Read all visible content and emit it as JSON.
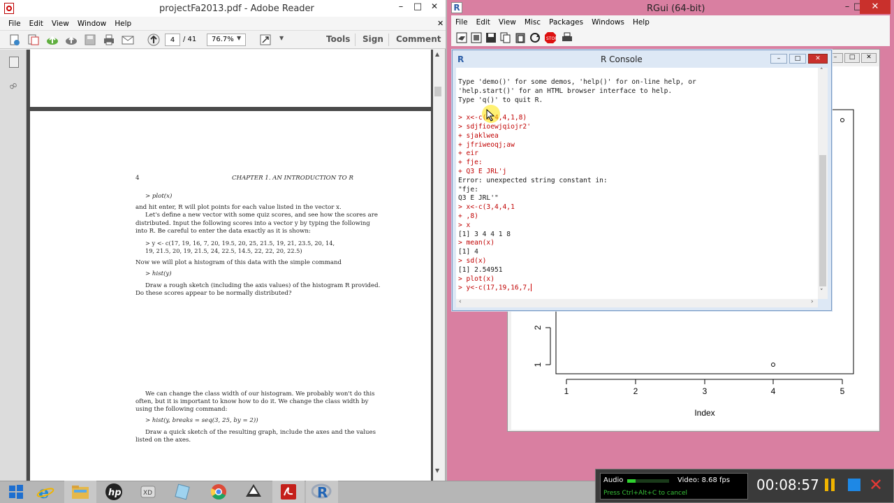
{
  "reader": {
    "title": "projectFa2013.pdf - Adobe Reader",
    "menu": [
      "File",
      "Edit",
      "View",
      "Window",
      "Help"
    ],
    "page_current": "4",
    "page_total": "/ 41",
    "zoom": "76.7%",
    "tools_label": "Tools",
    "sign_label": "Sign",
    "comment_label": "Comment",
    "page": {
      "page_number": "4",
      "chapter_header": "CHAPTER 1.   AN INTRODUCTION TO R",
      "lines": [
        "> plot(x)",
        "and hit enter, R will plot points for each value listed in the vector x.",
        "Let's define a new vector with some quiz scores, and see how the scores are",
        "distributed.  Input the following scores into a vector y by typing the following",
        "into R. Be careful to enter the data exactly as it is shown:",
        "> y <- c(17, 19, 16, 7, 20, 19.5, 20, 25, 21.5, 19, 21, 23.5, 20, 14,",
        "19, 21.5, 20, 19, 21.5, 24, 22.5, 14.5, 22, 22, 20, 22.5)",
        "Now we will plot a histogram of this data with the simple command",
        "> hist(y)",
        "Draw a rough sketch (including the axis values) of the histogram R provided.",
        "Do these scores appear to be normally distributed?",
        "We can change the class width of our histogram. We probably won't do this",
        "often, but it is important to know how to do it. We change the class width by",
        "using the following command:",
        "> hist(y, breaks = seq(3, 25, by = 2))",
        "Draw a quick sketch of the resulting graph, include the axes and the values",
        "listed on the axes."
      ]
    }
  },
  "rgui": {
    "title": "RGui (64-bit)",
    "menu": [
      "File",
      "Edit",
      "View",
      "Misc",
      "Packages",
      "Windows",
      "Help"
    ],
    "console_title": "R Console",
    "console_lines": [
      {
        "t": "Type 'demo()' for some demos, 'help()' for on-line help, or",
        "k": "out"
      },
      {
        "t": "'help.start()' for an HTML browser interface to help.",
        "k": "out"
      },
      {
        "t": "Type 'q()' to quit R.",
        "k": "out"
      },
      {
        "t": "",
        "k": "out"
      },
      {
        "t": "> x<-c(3,4,4,1,8)",
        "k": "in"
      },
      {
        "t": "> sdjfioewjqiojr2'",
        "k": "in"
      },
      {
        "t": "+ sjaklwea",
        "k": "in"
      },
      {
        "t": "+ jfriweoqj;aw",
        "k": "in"
      },
      {
        "t": "+ eir",
        "k": "in"
      },
      {
        "t": "+ fje:",
        "k": "in"
      },
      {
        "t": "+ Q3 E JRL'j",
        "k": "in"
      },
      {
        "t": "Error: unexpected string constant in:",
        "k": "out"
      },
      {
        "t": "\"fje:",
        "k": "out"
      },
      {
        "t": "Q3 E JRL'\"",
        "k": "out"
      },
      {
        "t": "> x<-c(3,4,4,1",
        "k": "in"
      },
      {
        "t": "+ ,8)",
        "k": "in"
      },
      {
        "t": "> x",
        "k": "in"
      },
      {
        "t": "[1] 3 4 4 1 8",
        "k": "out"
      },
      {
        "t": "> mean(x)",
        "k": "in"
      },
      {
        "t": "[1] 4",
        "k": "out"
      },
      {
        "t": "> sd(x)",
        "k": "in"
      },
      {
        "t": "[1] 2.54951",
        "k": "out"
      },
      {
        "t": "> plot(x)",
        "k": "in"
      },
      {
        "t": "> y<-c(17,19,16,7,",
        "k": "in"
      }
    ],
    "plot": {
      "x_ticks": [
        "1",
        "2",
        "3",
        "4",
        "5"
      ],
      "y_ticks": [
        "1",
        "2"
      ],
      "xlabel": "Index"
    }
  },
  "recorder": {
    "audio_label": "Audio",
    "video_label": "Video: 8.68 fps",
    "hint": "Press Ctrl+Alt+C to cancel",
    "timer": "00:08:57"
  }
}
